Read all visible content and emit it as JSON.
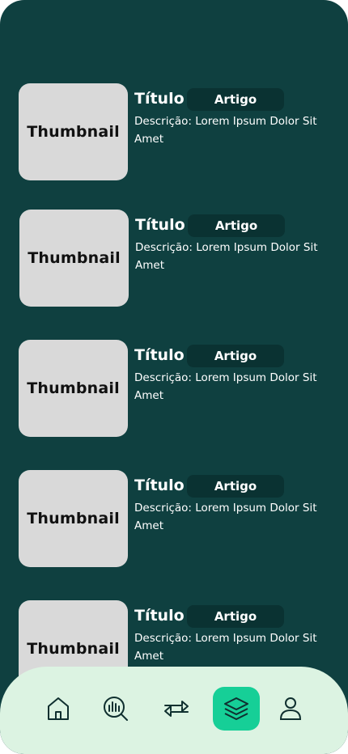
{
  "cards": [
    {
      "thumbnail": "Thumbnail",
      "title": "Título",
      "badge": "Artigo",
      "description": "Descrição: Lorem Ipsum Dolor Sit Amet"
    },
    {
      "thumbnail": "Thumbnail",
      "title": "Título",
      "badge": "Artigo",
      "description": "Descrição: Lorem Ipsum Dolor Sit Amet"
    },
    {
      "thumbnail": "Thumbnail",
      "title": "Título",
      "badge": "Artigo",
      "description": "Descrição: Lorem Ipsum Dolor Sit Amet"
    },
    {
      "thumbnail": "Thumbnail",
      "title": "Título",
      "badge": "Artigo",
      "description": "Descrição: Lorem Ipsum Dolor Sit Amet"
    },
    {
      "thumbnail": "Thumbnail",
      "title": "Título",
      "badge": "Artigo",
      "description": "Descrição: Lorem Ipsum Dolor Sit Amet"
    }
  ],
  "nav": {
    "items": [
      {
        "icon": "home-icon"
      },
      {
        "icon": "analytics-search-icon"
      },
      {
        "icon": "transfer-arrows-icon"
      },
      {
        "icon": "layers-icon",
        "active": true
      },
      {
        "icon": "user-icon"
      }
    ]
  },
  "colors": {
    "background": "#0f4040",
    "badge": "#0a3232",
    "thumbnail": "#d9d9d9",
    "nav_background": "#dcf3e2",
    "nav_active": "#16cf97"
  }
}
